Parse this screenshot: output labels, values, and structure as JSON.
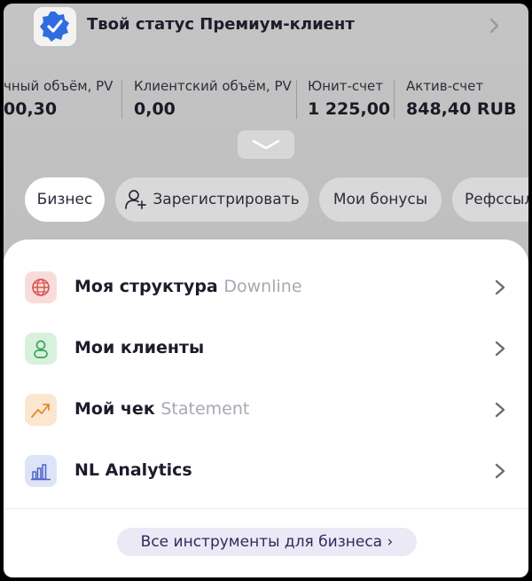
{
  "status": {
    "text": "Твой статус Премиум-клиент",
    "badge_icon": "verified-check-icon",
    "accent": "#2f6ce0"
  },
  "stats": [
    {
      "label": "чный объём, PV",
      "value": "00,30"
    },
    {
      "label": "Клиентский объём, PV",
      "value": "0,00"
    },
    {
      "label": "Юнит-счет",
      "value": "1 225,00"
    },
    {
      "label": "Актив-счет",
      "value": "848,40 RUB"
    }
  ],
  "pills": [
    {
      "label": "Бизнес",
      "active": true
    },
    {
      "label": "Зарегистрировать",
      "icon": "add-person-icon"
    },
    {
      "label": "Мои бонусы"
    },
    {
      "label": "Рефссыл"
    }
  ],
  "menu": [
    {
      "title": "Моя структура",
      "subtitle": "Downline",
      "icon": "globe-icon",
      "icon_bg": "#f8dcdc",
      "icon_color": "#d9534f"
    },
    {
      "title": "Мои клиенты",
      "subtitle": "",
      "icon": "person-icon",
      "icon_bg": "#d8f1dc",
      "icon_color": "#3aa35a"
    },
    {
      "title": "Мой чек",
      "subtitle": "Statement",
      "icon": "trend-up-icon",
      "icon_bg": "#fbe6cf",
      "icon_color": "#e08a2e"
    },
    {
      "title": "NL Analytics",
      "subtitle": "",
      "icon": "bar-chart-icon",
      "icon_bg": "#dde3f8",
      "icon_color": "#4a63c9"
    }
  ],
  "all_tools": "Все инструменты для бизнеса ›"
}
